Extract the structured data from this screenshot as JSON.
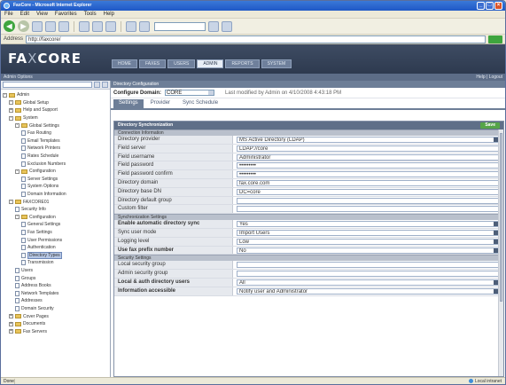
{
  "browser": {
    "title": "FaxCore - Microsoft Internet Explorer",
    "menu": [
      "File",
      "Edit",
      "View",
      "Favorites",
      "Tools",
      "Help"
    ],
    "address_label": "Address",
    "address_url": "http://faxcore/"
  },
  "app": {
    "logo_left": "FA",
    "logo_x": "X",
    "logo_right": "CORE",
    "tabs": [
      {
        "label": "HOME",
        "active": false
      },
      {
        "label": "FAXES",
        "active": false
      },
      {
        "label": "USERS",
        "active": false
      },
      {
        "label": "ADMIN",
        "active": true
      },
      {
        "label": "REPORTS",
        "active": false
      },
      {
        "label": "SYSTEM",
        "active": false
      }
    ],
    "subbar_left": "Admin Options",
    "subbar_right": "Help | Logout"
  },
  "sidebar": {
    "items": [
      {
        "label": "Admin",
        "indent": 0,
        "type": "folder",
        "expand": "-"
      },
      {
        "label": "Global Setup",
        "indent": 1,
        "type": "folder",
        "expand": "-"
      },
      {
        "label": "Help and Support",
        "indent": 1,
        "type": "folder",
        "expand": "+"
      },
      {
        "label": "System",
        "indent": 1,
        "type": "folder",
        "expand": "-"
      },
      {
        "label": "Global Settings",
        "indent": 2,
        "type": "folder",
        "expand": "-"
      },
      {
        "label": "Fax Routing",
        "indent": 3,
        "type": "doc"
      },
      {
        "label": "Email Templates",
        "indent": 3,
        "type": "doc"
      },
      {
        "label": "Network Printers",
        "indent": 3,
        "type": "doc"
      },
      {
        "label": "Rates Schedule",
        "indent": 3,
        "type": "doc"
      },
      {
        "label": "Exclusion Numbers",
        "indent": 3,
        "type": "doc"
      },
      {
        "label": "Configuration",
        "indent": 2,
        "type": "folder",
        "expand": "-"
      },
      {
        "label": "Server Settings",
        "indent": 3,
        "type": "doc"
      },
      {
        "label": "System Options",
        "indent": 3,
        "type": "doc"
      },
      {
        "label": "Domain Information",
        "indent": 3,
        "type": "doc"
      },
      {
        "label": "FAXCORE01",
        "indent": 1,
        "type": "folder",
        "expand": "-"
      },
      {
        "label": "Security Info",
        "indent": 2,
        "type": "doc"
      },
      {
        "label": "Configuration",
        "indent": 2,
        "type": "folder",
        "expand": "-"
      },
      {
        "label": "General Settings",
        "indent": 3,
        "type": "doc"
      },
      {
        "label": "Fax Settings",
        "indent": 3,
        "type": "doc"
      },
      {
        "label": "User Permissions",
        "indent": 3,
        "type": "doc"
      },
      {
        "label": "Authentication",
        "indent": 3,
        "type": "doc"
      },
      {
        "label": "Directory Types",
        "indent": 3,
        "type": "doc",
        "selected": true
      },
      {
        "label": "Transmission",
        "indent": 3,
        "type": "doc"
      },
      {
        "label": "Users",
        "indent": 2,
        "type": "doc"
      },
      {
        "label": "Groups",
        "indent": 2,
        "type": "doc"
      },
      {
        "label": "Address Books",
        "indent": 2,
        "type": "doc"
      },
      {
        "label": "Network Templates",
        "indent": 2,
        "type": "doc"
      },
      {
        "label": "Addresses",
        "indent": 2,
        "type": "doc"
      },
      {
        "label": "Domain Security",
        "indent": 2,
        "type": "doc"
      },
      {
        "label": "Cover Pages",
        "indent": 1,
        "type": "folder",
        "expand": "+"
      },
      {
        "label": "Documents",
        "indent": 1,
        "type": "folder",
        "expand": "+"
      },
      {
        "label": "Fax Servers",
        "indent": 1,
        "type": "folder",
        "expand": "+"
      }
    ]
  },
  "content": {
    "section_title": "Directory Configuration",
    "config_label": "Configure Domain:",
    "config_value": "CORE",
    "config_note": "Last modified by Admin on 4/10/2008 4:43:18 PM",
    "sub_tabs": [
      {
        "label": "Settings",
        "active": true
      },
      {
        "label": "Provider",
        "active": false
      },
      {
        "label": "Sync Schedule",
        "active": false
      }
    ],
    "panel_title": "Directory Synchronization",
    "save_label": "Save",
    "groups": [
      {
        "title": "Connection Information",
        "rows": [
          {
            "key": "Directory provider",
            "value": "MS Active Directory (LDAP)",
            "select": true,
            "bold": false
          },
          {
            "key": "Field server",
            "value": "LDAP://core",
            "select": false,
            "bold": false
          },
          {
            "key": "Field username",
            "value": "Administrator",
            "select": false,
            "bold": false
          },
          {
            "key": "Field password",
            "value": "•••••••••",
            "select": false,
            "bold": false
          },
          {
            "key": "Field password confirm",
            "value": "•••••••••",
            "select": false,
            "bold": false
          },
          {
            "key": "Directory domain",
            "value": "fax.core.com",
            "select": false,
            "bold": false
          },
          {
            "key": "Directory base DN",
            "value": "DC=core",
            "select": false,
            "bold": false
          },
          {
            "key": "Directory default group",
            "value": "",
            "select": false,
            "bold": false
          },
          {
            "key": "Custom filter",
            "value": "",
            "select": false,
            "bold": false
          }
        ]
      },
      {
        "title": "Synchronization Settings",
        "rows": [
          {
            "key": "Enable automatic directory sync",
            "value": "Yes",
            "select": true,
            "bold": true
          },
          {
            "key": "Sync user mode",
            "value": "Import Users",
            "select": true,
            "bold": false
          },
          {
            "key": "Logging level",
            "value": "Low",
            "select": true,
            "bold": false
          },
          {
            "key": "Use fax prefix number",
            "value": "No",
            "select": true,
            "bold": true
          }
        ]
      },
      {
        "title": "Security Settings",
        "rows": [
          {
            "key": "Local security group",
            "value": "",
            "select": false,
            "bold": false
          },
          {
            "key": "Admin security group",
            "value": "",
            "select": false,
            "bold": false
          },
          {
            "key": "Local & auth directory users",
            "value": "All",
            "select": true,
            "bold": true
          },
          {
            "key": "Information accessible",
            "value": "Notify user and Administrator",
            "select": true,
            "bold": true
          }
        ]
      }
    ]
  },
  "status": {
    "left": "Done",
    "zone": "Local intranet"
  }
}
